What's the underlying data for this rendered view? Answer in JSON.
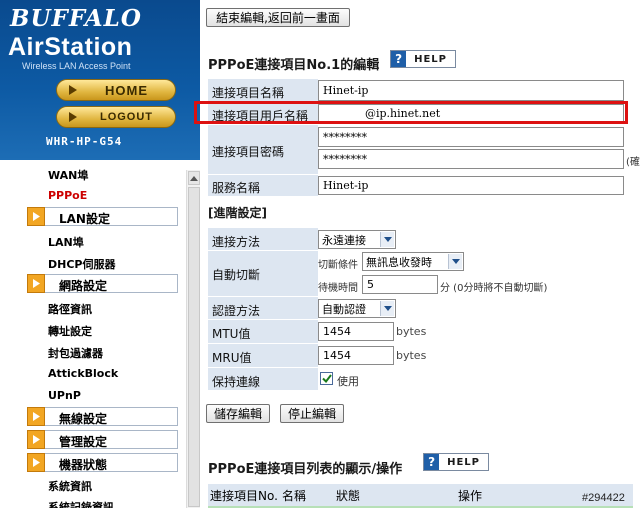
{
  "brand": {
    "company": "BUFFALO",
    "product": "AirStation",
    "tagline": "Wireless LAN Access Point",
    "model": "WHR-HP-G54",
    "home_label": "HOME",
    "logout_label": "LOGOUT"
  },
  "menu": {
    "items": [
      {
        "label": "WAN埠",
        "kind": "link"
      },
      {
        "label": "PPPoE",
        "kind": "link",
        "active": true
      },
      {
        "label": "LAN設定",
        "kind": "header"
      },
      {
        "label": "LAN埠",
        "kind": "link"
      },
      {
        "label": "DHCP伺服器",
        "kind": "link"
      },
      {
        "label": "網路設定",
        "kind": "header"
      },
      {
        "label": "路徑資訊",
        "kind": "link"
      },
      {
        "label": "轉址設定",
        "kind": "link"
      },
      {
        "label": "封包過濾器",
        "kind": "link"
      },
      {
        "label": "AttickBlock",
        "kind": "link"
      },
      {
        "label": "UPnP",
        "kind": "link"
      },
      {
        "label": "無線設定",
        "kind": "header"
      },
      {
        "label": "管理設定",
        "kind": "header"
      },
      {
        "label": "機器狀態",
        "kind": "header"
      },
      {
        "label": "系統資訊",
        "kind": "link"
      },
      {
        "label": "系統記錄資訊",
        "kind": "link"
      }
    ]
  },
  "main": {
    "top_button": "結束編輯,返回前一畫面",
    "edit_title": "PPPoE連接項目No.1的編輯",
    "help_label": "HELP",
    "fields": {
      "name_label": "連接項目名稱",
      "name_value": "Hinet-ip",
      "user_label": "連接項目用戶名稱",
      "user_value": "@ip.hinet.net",
      "password_label": "連接項目密碼",
      "password_value": "********",
      "password_confirm_value": "********",
      "confirm_hint": "(確",
      "service_label": "服務名稱",
      "service_value": "Hinet-ip"
    },
    "advanced_title": "[進階設定]",
    "advanced": {
      "connect_method_label": "連接方法",
      "connect_method_value": "永遠連接",
      "auto_disconnect_label": "自動切斷",
      "condition_label": "切斷條件",
      "condition_value": "無訊息收發時",
      "wait_label": "待機時間",
      "wait_value": "5",
      "wait_unit": "分 (0分時將不自動切斷)",
      "auth_label": "認證方法",
      "auth_value": "自動認證",
      "mtu_label": "MTU值",
      "mtu_value": "1454",
      "mtu_unit": "bytes",
      "mru_label": "MRU值",
      "mru_value": "1454",
      "mru_unit": "bytes",
      "keepalive_label": "保持連線",
      "keepalive_checked": true,
      "keepalive_text": "使用"
    },
    "save_button": "儲存編輯",
    "stop_button": "停止編輯",
    "list_title": "PPPoE連接項目列表的顯示/操作",
    "list_columns": [
      "連接項目No.",
      "名稱",
      "狀態",
      "操作"
    ]
  },
  "watermark": "#294422",
  "colors": {
    "brand_blue": "#0d5aa4",
    "label_bg": "#dde6f1",
    "highlight": "#dd1111",
    "active_link": "#cc0000",
    "menu_accent": "#f2a623"
  }
}
